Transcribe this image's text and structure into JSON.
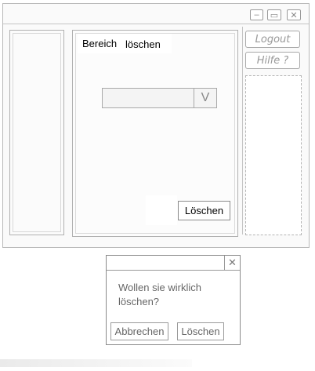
{
  "window": {
    "heading_part1": "Bereich",
    "heading_part2": "löschen",
    "combo_arrow": "V",
    "delete_button": "Löschen",
    "logout_button": "Logout",
    "help_button": "Hilfe ?",
    "titlebar_buttons": {
      "minimize_icon": "minimize-icon",
      "maximize_icon": "maximize-icon",
      "close_icon": "close-icon"
    }
  },
  "dialog": {
    "close_glyph": "✕",
    "message": "Wollen sie wirklich löschen?",
    "cancel_button": "Abbrechen",
    "confirm_button": "Löschen"
  },
  "colors": {
    "sketch_line": "#b0b0b0",
    "text": "#000000",
    "muted_text": "#666666"
  }
}
